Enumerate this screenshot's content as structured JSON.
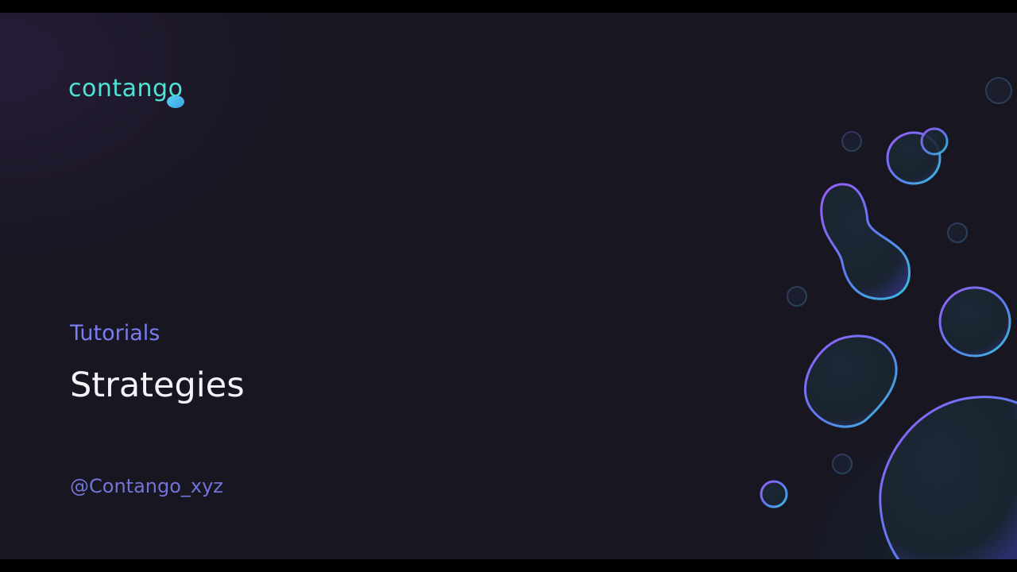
{
  "brand": {
    "logo_text": "contango",
    "accent_color": "#4fe3d6"
  },
  "slide": {
    "section_label": "Tutorials",
    "title": "Strategies",
    "handle": "@Contango_xyz"
  },
  "colors": {
    "background": "#171621",
    "section": "#7a7cf0",
    "title": "#f4f4f8",
    "handle": "#7274d8",
    "bubble_edge_purple": "#8a5cf6",
    "bubble_edge_cyan": "#3fb8d8"
  },
  "icons": {
    "logo_mark": "blob-icon",
    "decoration": "bubble-icon"
  }
}
